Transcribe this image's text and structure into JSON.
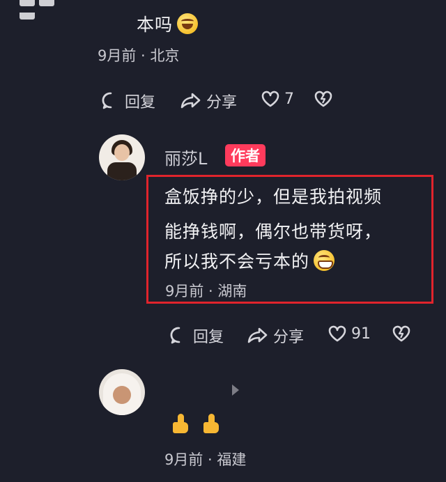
{
  "comment1": {
    "text_tail": "本吗",
    "emoji": "laughing-emoji",
    "meta": "9月前 · 北京",
    "actions": {
      "reply": "回复",
      "share": "分享",
      "likes": "7"
    }
  },
  "comment2": {
    "author": "丽莎L",
    "badge": "作者",
    "line1": "盒饭挣的少，但是我拍视频",
    "line2": "能挣钱啊，偶尔也带货呀，",
    "line3": "所以我不会亏本的",
    "emoji": "grinning-emoji",
    "meta": "9月前 · 湖南",
    "actions": {
      "reply": "回复",
      "share": "分享",
      "likes": "91"
    }
  },
  "comment3": {
    "emojis": [
      "thumbs-up-emoji",
      "thumbs-up-emoji"
    ],
    "meta": "9月前 · 福建"
  },
  "colors": {
    "background": "#1d1f2b",
    "badge": "#ff3b5c",
    "highlight_border": "#e0242c"
  }
}
